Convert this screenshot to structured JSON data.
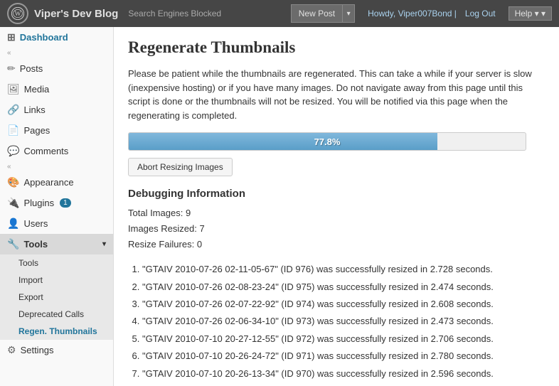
{
  "header": {
    "wp_logo": "⊛",
    "site_title": "Viper's Dev Blog",
    "site_subtitle": "Search Engines Blocked",
    "new_post_label": "New Post",
    "howdy_prefix": "Howdy,",
    "username": "Viper007Bond",
    "separator": "|",
    "logout_label": "Log Out",
    "help_label": "Help"
  },
  "sidebar": {
    "dashboard_label": "Dashboard",
    "collapse_arrow_1": "«",
    "collapse_arrow_2": "«",
    "items": [
      {
        "id": "posts",
        "label": "Posts",
        "icon": "🔗"
      },
      {
        "id": "media",
        "label": "Media",
        "icon": "🖼"
      },
      {
        "id": "links",
        "label": "Links",
        "icon": "🔗"
      },
      {
        "id": "pages",
        "label": "Pages",
        "icon": "📄"
      },
      {
        "id": "comments",
        "label": "Comments",
        "icon": "💬"
      }
    ],
    "appearance_label": "Appearance",
    "appearance_icon": "🎨",
    "plugins_label": "Plugins",
    "plugins_icon": "🔌",
    "plugins_badge": "1",
    "users_label": "Users",
    "users_icon": "👤",
    "tools_label": "Tools",
    "tools_icon": "🔧",
    "tools_arrow": "▾",
    "submenu": [
      {
        "id": "tools",
        "label": "Tools"
      },
      {
        "id": "import",
        "label": "Import"
      },
      {
        "id": "export",
        "label": "Export"
      },
      {
        "id": "deprecated-calls",
        "label": "Deprecated Calls"
      },
      {
        "id": "regen-thumbnails",
        "label": "Regen. Thumbnails",
        "active": true
      }
    ],
    "settings_label": "Settings",
    "settings_icon": "⚙"
  },
  "main": {
    "page_title": "Regenerate Thumbnails",
    "description": "Please be patient while the thumbnails are regenerated. This can take a while if your server is slow (inexpensive hosting) or if you have many images. Do not navigate away from this page until this script is done or the thumbnails will not be resized. You will be notified via this page when the regenerating is completed.",
    "progress_percent": 77.8,
    "progress_label": "77.8%",
    "abort_btn_label": "Abort Resizing Images",
    "debug_title": "Debugging Information",
    "total_images_label": "Total Images:",
    "total_images_value": "9",
    "images_resized_label": "Images Resized:",
    "images_resized_value": "7",
    "resize_failures_label": "Resize Failures:",
    "resize_failures_value": "0",
    "resize_list": [
      "\"GTAIV 2010-07-26 02-11-05-67\" (ID 976) was successfully resized in 2.728 seconds.",
      "\"GTAIV 2010-07-26 02-08-23-24\" (ID 975) was successfully resized in 2.474 seconds.",
      "\"GTAIV 2010-07-26 02-07-22-92\" (ID 974) was successfully resized in 2.608 seconds.",
      "\"GTAIV 2010-07-26 02-06-34-10\" (ID 973) was successfully resized in 2.473 seconds.",
      "\"GTAIV 2010-07-10 20-27-12-55\" (ID 972) was successfully resized in 2.706 seconds.",
      "\"GTAIV 2010-07-10 20-26-24-72\" (ID 971) was successfully resized in 2.780 seconds.",
      "\"GTAIV 2010-07-10 20-26-13-34\" (ID 970) was successfully resized in 2.596 seconds."
    ]
  }
}
